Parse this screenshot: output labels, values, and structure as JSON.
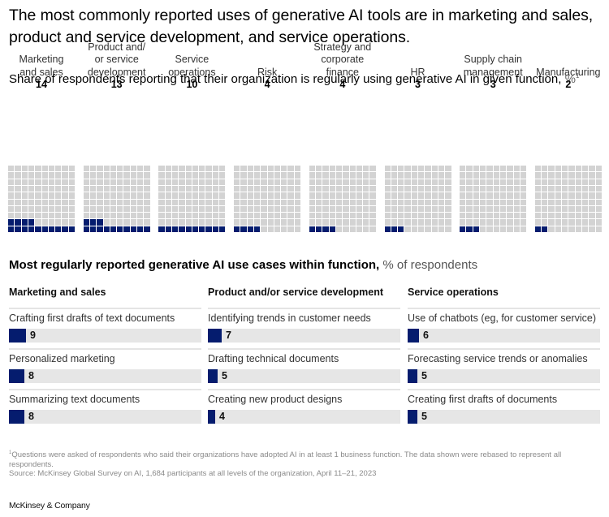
{
  "title": "The most commonly reported uses of generative AI tools are in marketing and sales, product and service development, and service operations.",
  "subtitle": {
    "text": "Share of respondents reporting that their organization is regularly using generative AI in given function,",
    "unit": "%",
    "footnote_marker": "1"
  },
  "colors": {
    "accent": "#051c6e",
    "empty_cell": "#d3d3d3",
    "bar_track": "#e6e6e6"
  },
  "chart_data": [
    {
      "type": "waffle",
      "title": "Share of respondents reporting that their organization is regularly using generative AI in given function, %",
      "grid": [
        10,
        10
      ],
      "categories": [
        "Marketing and sales",
        "Product and/or service development",
        "Service operations",
        "Risk",
        "Strategy and corporate finance",
        "HR",
        "Supply chain management",
        "Manufacturing"
      ],
      "labels_lines": [
        [
          "Marketing",
          "and sales"
        ],
        [
          "Product and/",
          "or service",
          "development"
        ],
        [
          "Service",
          "operations"
        ],
        [
          "Risk"
        ],
        [
          "Strategy and",
          "corporate",
          "finance"
        ],
        [
          "HR"
        ],
        [
          "Supply chain",
          "management"
        ],
        [
          "Manufacturing"
        ]
      ],
      "values": [
        14,
        13,
        10,
        4,
        4,
        3,
        3,
        2
      ],
      "max": 100
    },
    {
      "type": "bar",
      "title": "Most regularly reported generative AI use cases within function, % of respondents",
      "xlim": [
        0,
        100
      ],
      "groups": [
        {
          "name": "Marketing and sales",
          "categories": [
            "Crafting first drafts of text documents",
            "Personalized marketing",
            "Summarizing text documents"
          ],
          "values": [
            9,
            8,
            8
          ]
        },
        {
          "name": "Product and/or service development",
          "categories": [
            "Identifying trends in customer needs",
            "Drafting technical documents",
            "Creating new product designs"
          ],
          "values": [
            7,
            5,
            4
          ]
        },
        {
          "name": "Service operations",
          "categories": [
            "Use of chatbots (eg, for customer service)",
            "Forecasting service trends or anomalies",
            "Creating first drafts of documents"
          ],
          "values": [
            6,
            5,
            5
          ]
        }
      ]
    }
  ],
  "section2": {
    "title_bold": "Most regularly reported generative AI use cases within function,",
    "title_unit": "% of respondents"
  },
  "footnotes": {
    "marker": "1",
    "note": "Questions were asked of respondents who said their organizations have adopted AI in at least 1 business function. The data shown were rebased to represent all respondents.",
    "source": "Source: McKinsey Global Survey on AI, 1,684 participants at all levels of the organization, April 11–21, 2023"
  },
  "brand": "McKinsey & Company"
}
